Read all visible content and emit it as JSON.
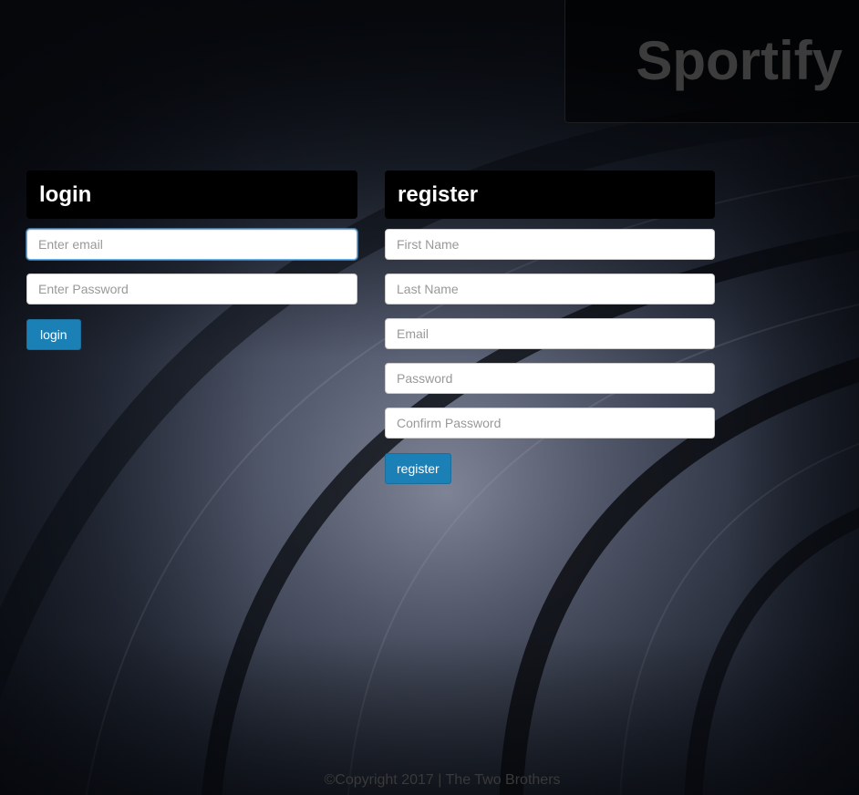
{
  "brand": {
    "title": "Sportify"
  },
  "login": {
    "heading": "login",
    "email_placeholder": "Enter email",
    "password_placeholder": "Enter Password",
    "submit_label": "login"
  },
  "register": {
    "heading": "register",
    "first_name_placeholder": "First Name",
    "last_name_placeholder": "Last Name",
    "email_placeholder": "Email",
    "password_placeholder": "Password",
    "confirm_password_placeholder": "Confirm Password",
    "submit_label": "register"
  },
  "footer": {
    "copyright": "©Copyright 2017 | The Two Brothers"
  },
  "colors": {
    "button_primary": "#1a80b6",
    "header_bg": "#000000",
    "brand_text": "#3c3c3c",
    "focus_border": "#66afe9"
  }
}
